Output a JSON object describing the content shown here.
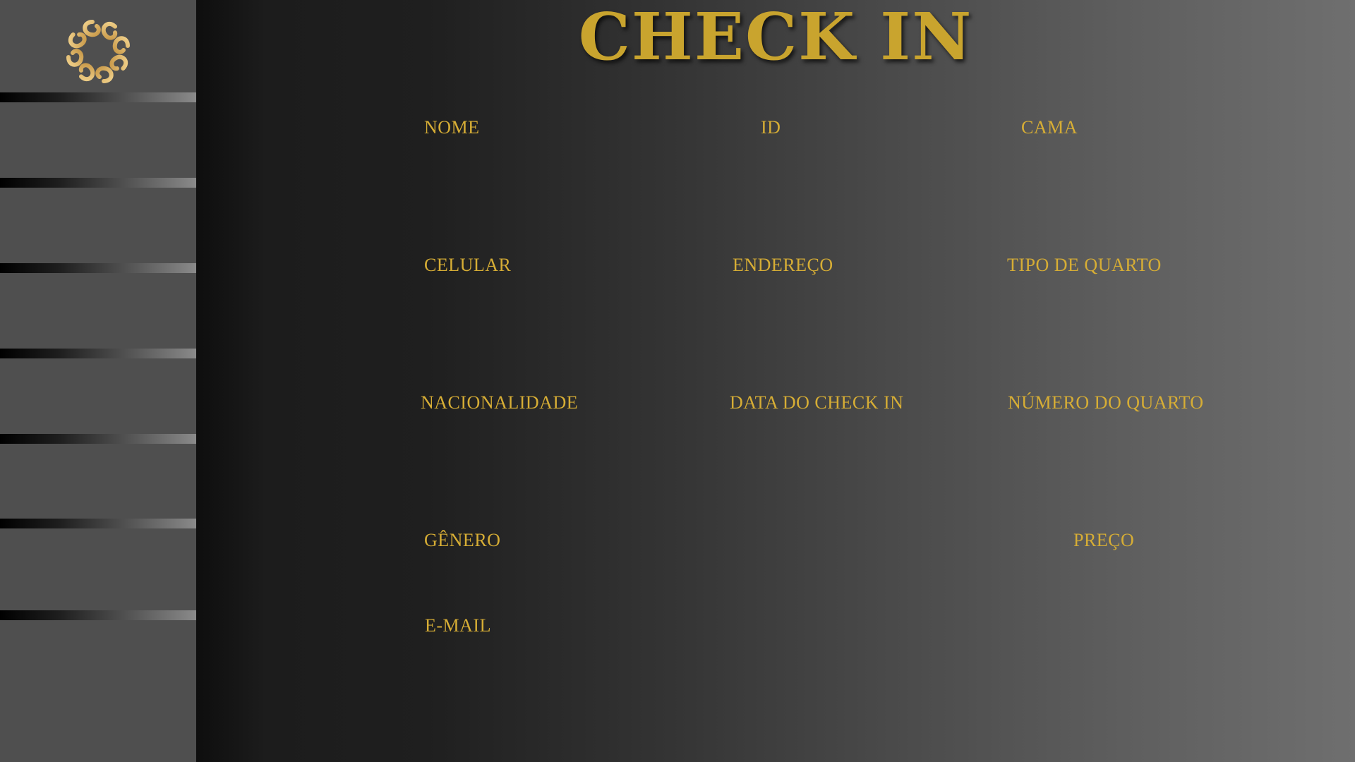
{
  "app": {
    "title": "CHECK IN",
    "accent_color": "#c9a42e",
    "logo_icon": "ornamental-flower-icon"
  },
  "sidebar": {
    "items": [
      {
        "label": ""
      },
      {
        "label": ""
      },
      {
        "label": ""
      },
      {
        "label": ""
      },
      {
        "label": ""
      },
      {
        "label": ""
      }
    ]
  },
  "form": {
    "nome": {
      "label": "NOME",
      "value": ""
    },
    "id": {
      "label": "ID",
      "value": ""
    },
    "cama": {
      "label": "CAMA",
      "value": ""
    },
    "celular": {
      "label": "CELULAR",
      "value": ""
    },
    "endereco": {
      "label": "ENDEREÇO",
      "value": ""
    },
    "tipo_quarto": {
      "label": "TIPO DE QUARTO",
      "value": ""
    },
    "nacionalidade": {
      "label": "NACIONALIDADE",
      "value": ""
    },
    "data_check_in": {
      "label": "DATA DO CHECK IN",
      "value": ""
    },
    "numero_quarto": {
      "label": "NÚMERO DO QUARTO",
      "value": ""
    },
    "genero": {
      "label": "GÊNERO",
      "value": ""
    },
    "preco": {
      "label": "PREÇO",
      "value": ""
    },
    "email": {
      "label": "E-MAIL",
      "value": ""
    }
  }
}
